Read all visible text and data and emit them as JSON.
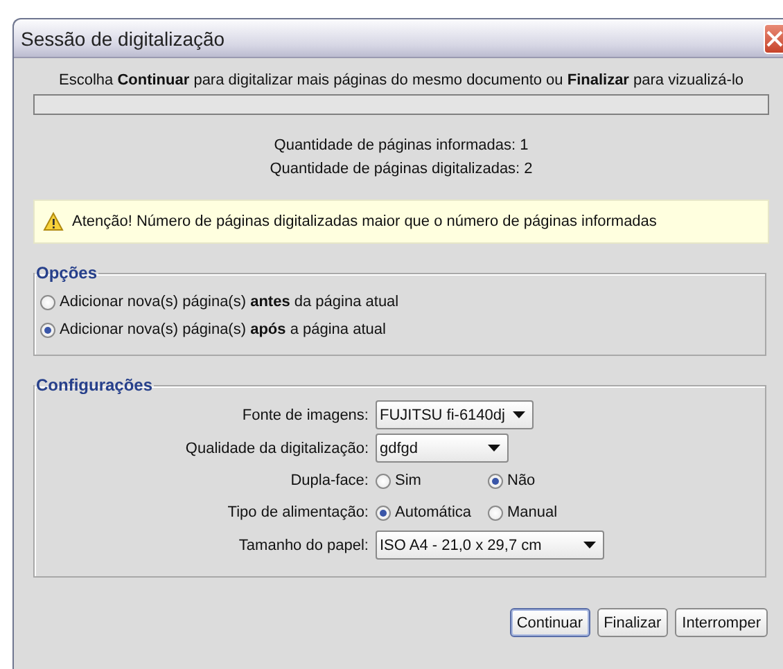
{
  "window": {
    "title": "Sessão de digitalização"
  },
  "instruction": "Escolha **Continuar** para digitalizar mais páginas do mesmo documento ou **Finalizar** para vizualizá-lo",
  "counts": [
    "Quantidade de páginas informadas: 1",
    "Quantidade de páginas digitalizadas: 2"
  ],
  "warning": "Atenção! Número de páginas digitalizadas maior que o número de páginas informadas",
  "options": {
    "legend": "Opções",
    "items": [
      {
        "label": "Adicionar nova(s) página(s) **antes** da página atual",
        "selected": false
      },
      {
        "label": "Adicionar nova(s) página(s) **após** a página atual",
        "selected": true
      }
    ]
  },
  "settings": {
    "legend": "Configurações",
    "rows": [
      {
        "kind": "select",
        "label": "Fonte de imagens:",
        "value": "FUJITSU fi-6140dj"
      },
      {
        "kind": "select",
        "label": "Qualidade da digitalização:",
        "value": "gdfgd"
      },
      {
        "kind": "radio",
        "label": "Dupla-face:",
        "choices": [
          {
            "label": "Sim",
            "selected": false
          },
          {
            "label": "Não",
            "selected": true
          }
        ]
      },
      {
        "kind": "radio",
        "label": "Tipo de alimentação:",
        "choices": [
          {
            "label": "Automática",
            "selected": true
          },
          {
            "label": "Manual",
            "selected": false
          }
        ]
      },
      {
        "kind": "select",
        "label": "Tamanho do papel:",
        "value": "ISO A4 - 21,0 x 29,7 cm"
      }
    ]
  },
  "buttons": [
    {
      "label": "Continuar",
      "focused": true
    },
    {
      "label": "Finalizar",
      "focused": false
    },
    {
      "label": "Interromper",
      "focused": false
    }
  ]
}
